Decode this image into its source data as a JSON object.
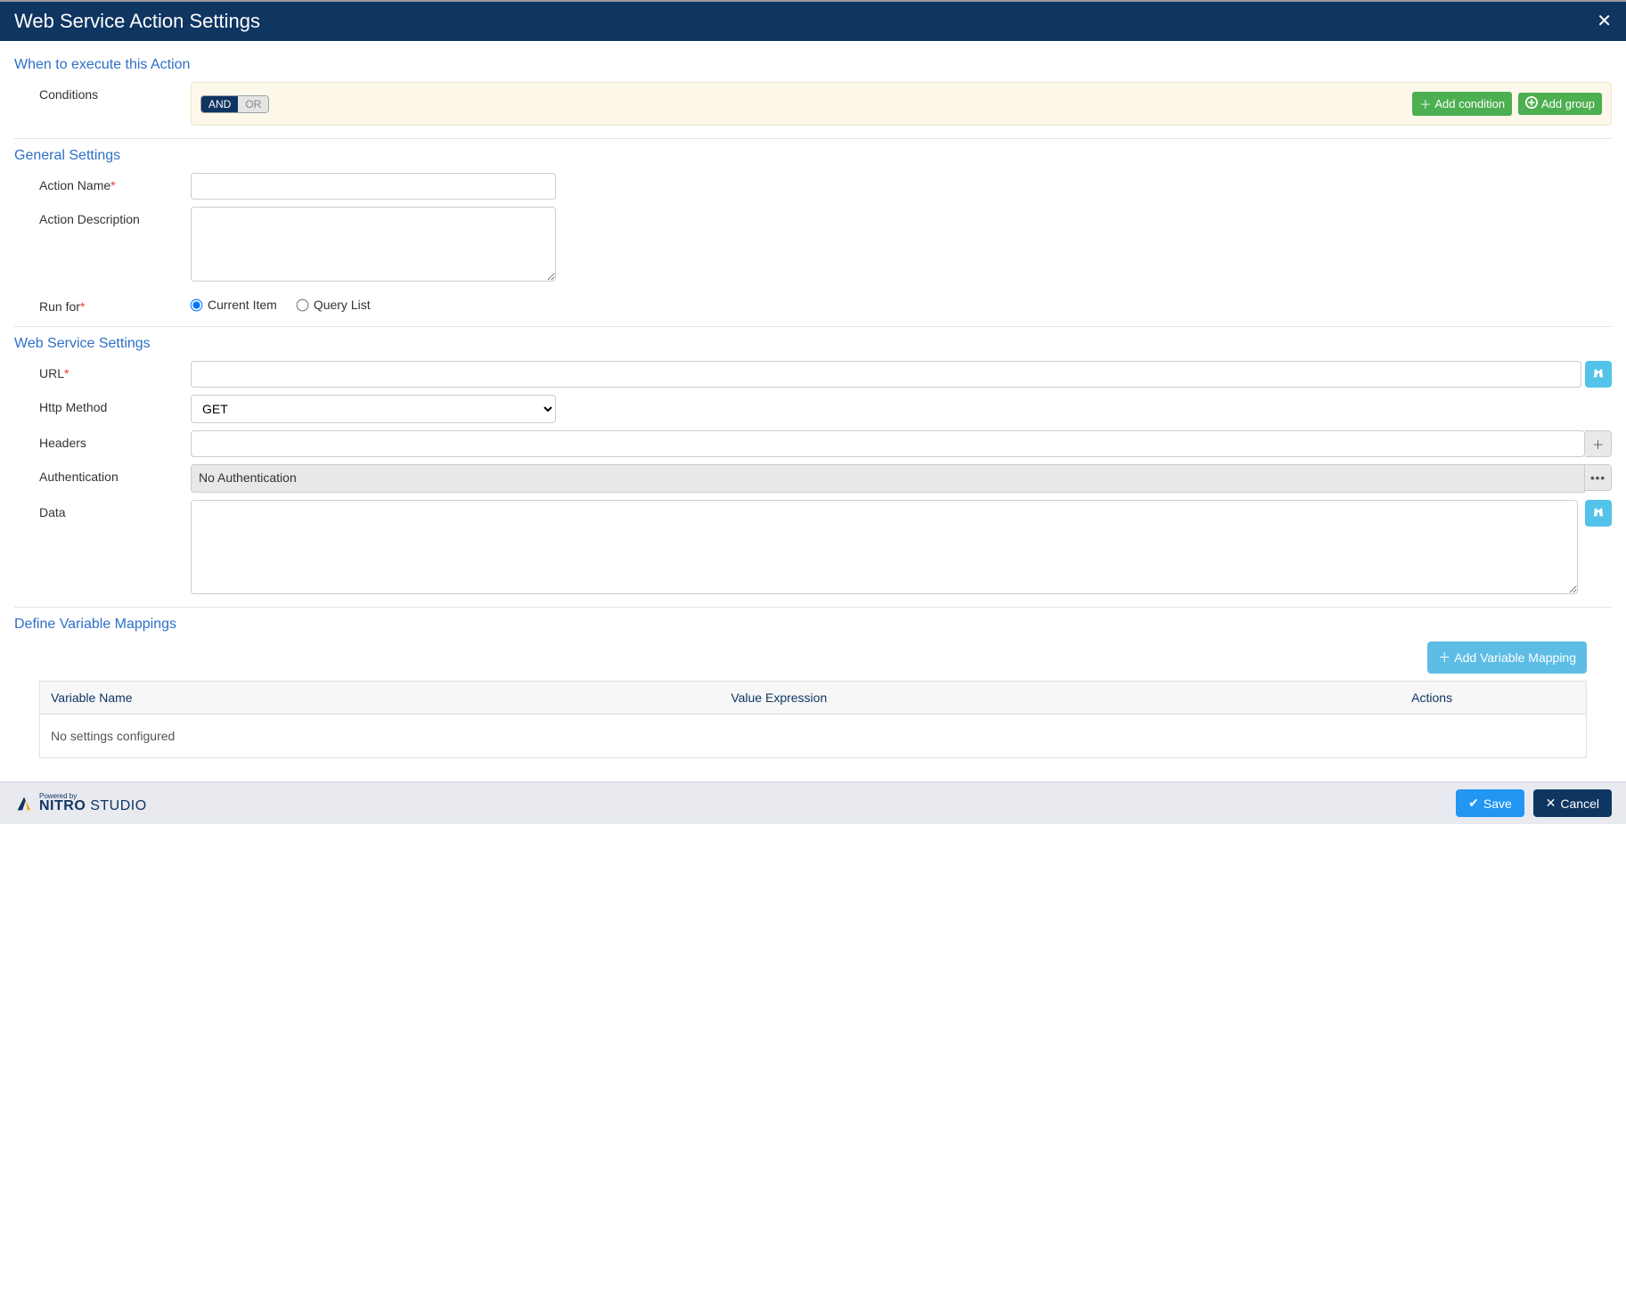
{
  "header": {
    "title": "Web Service Action Settings"
  },
  "sections": {
    "when": "When to execute this Action",
    "general": "General Settings",
    "websvc": "Web Service Settings",
    "mappings": "Define Variable Mappings"
  },
  "conditions": {
    "label": "Conditions",
    "and": "AND",
    "or": "OR",
    "add_condition": "Add condition",
    "add_group": "Add group"
  },
  "general": {
    "action_name_label": "Action Name",
    "action_name_value": "",
    "action_desc_label": "Action Description",
    "action_desc_value": "",
    "run_for_label": "Run for",
    "run_for_options": {
      "current_item": "Current Item",
      "query_list": "Query List"
    },
    "run_for_selected": "current_item"
  },
  "websvc": {
    "url_label": "URL",
    "url_value": "",
    "http_method_label": "Http Method",
    "http_method_value": "GET",
    "headers_label": "Headers",
    "headers_value": "",
    "auth_label": "Authentication",
    "auth_value": "No Authentication",
    "data_label": "Data",
    "data_value": ""
  },
  "mappings": {
    "add_btn": "Add Variable Mapping",
    "columns": {
      "var_name": "Variable Name",
      "value_expr": "Value Expression",
      "actions": "Actions"
    },
    "empty": "No settings configured"
  },
  "footer": {
    "brand_super": "Powered by",
    "brand_main": "NITRO",
    "brand_sub": "STUDIO",
    "save": "Save",
    "cancel": "Cancel"
  }
}
